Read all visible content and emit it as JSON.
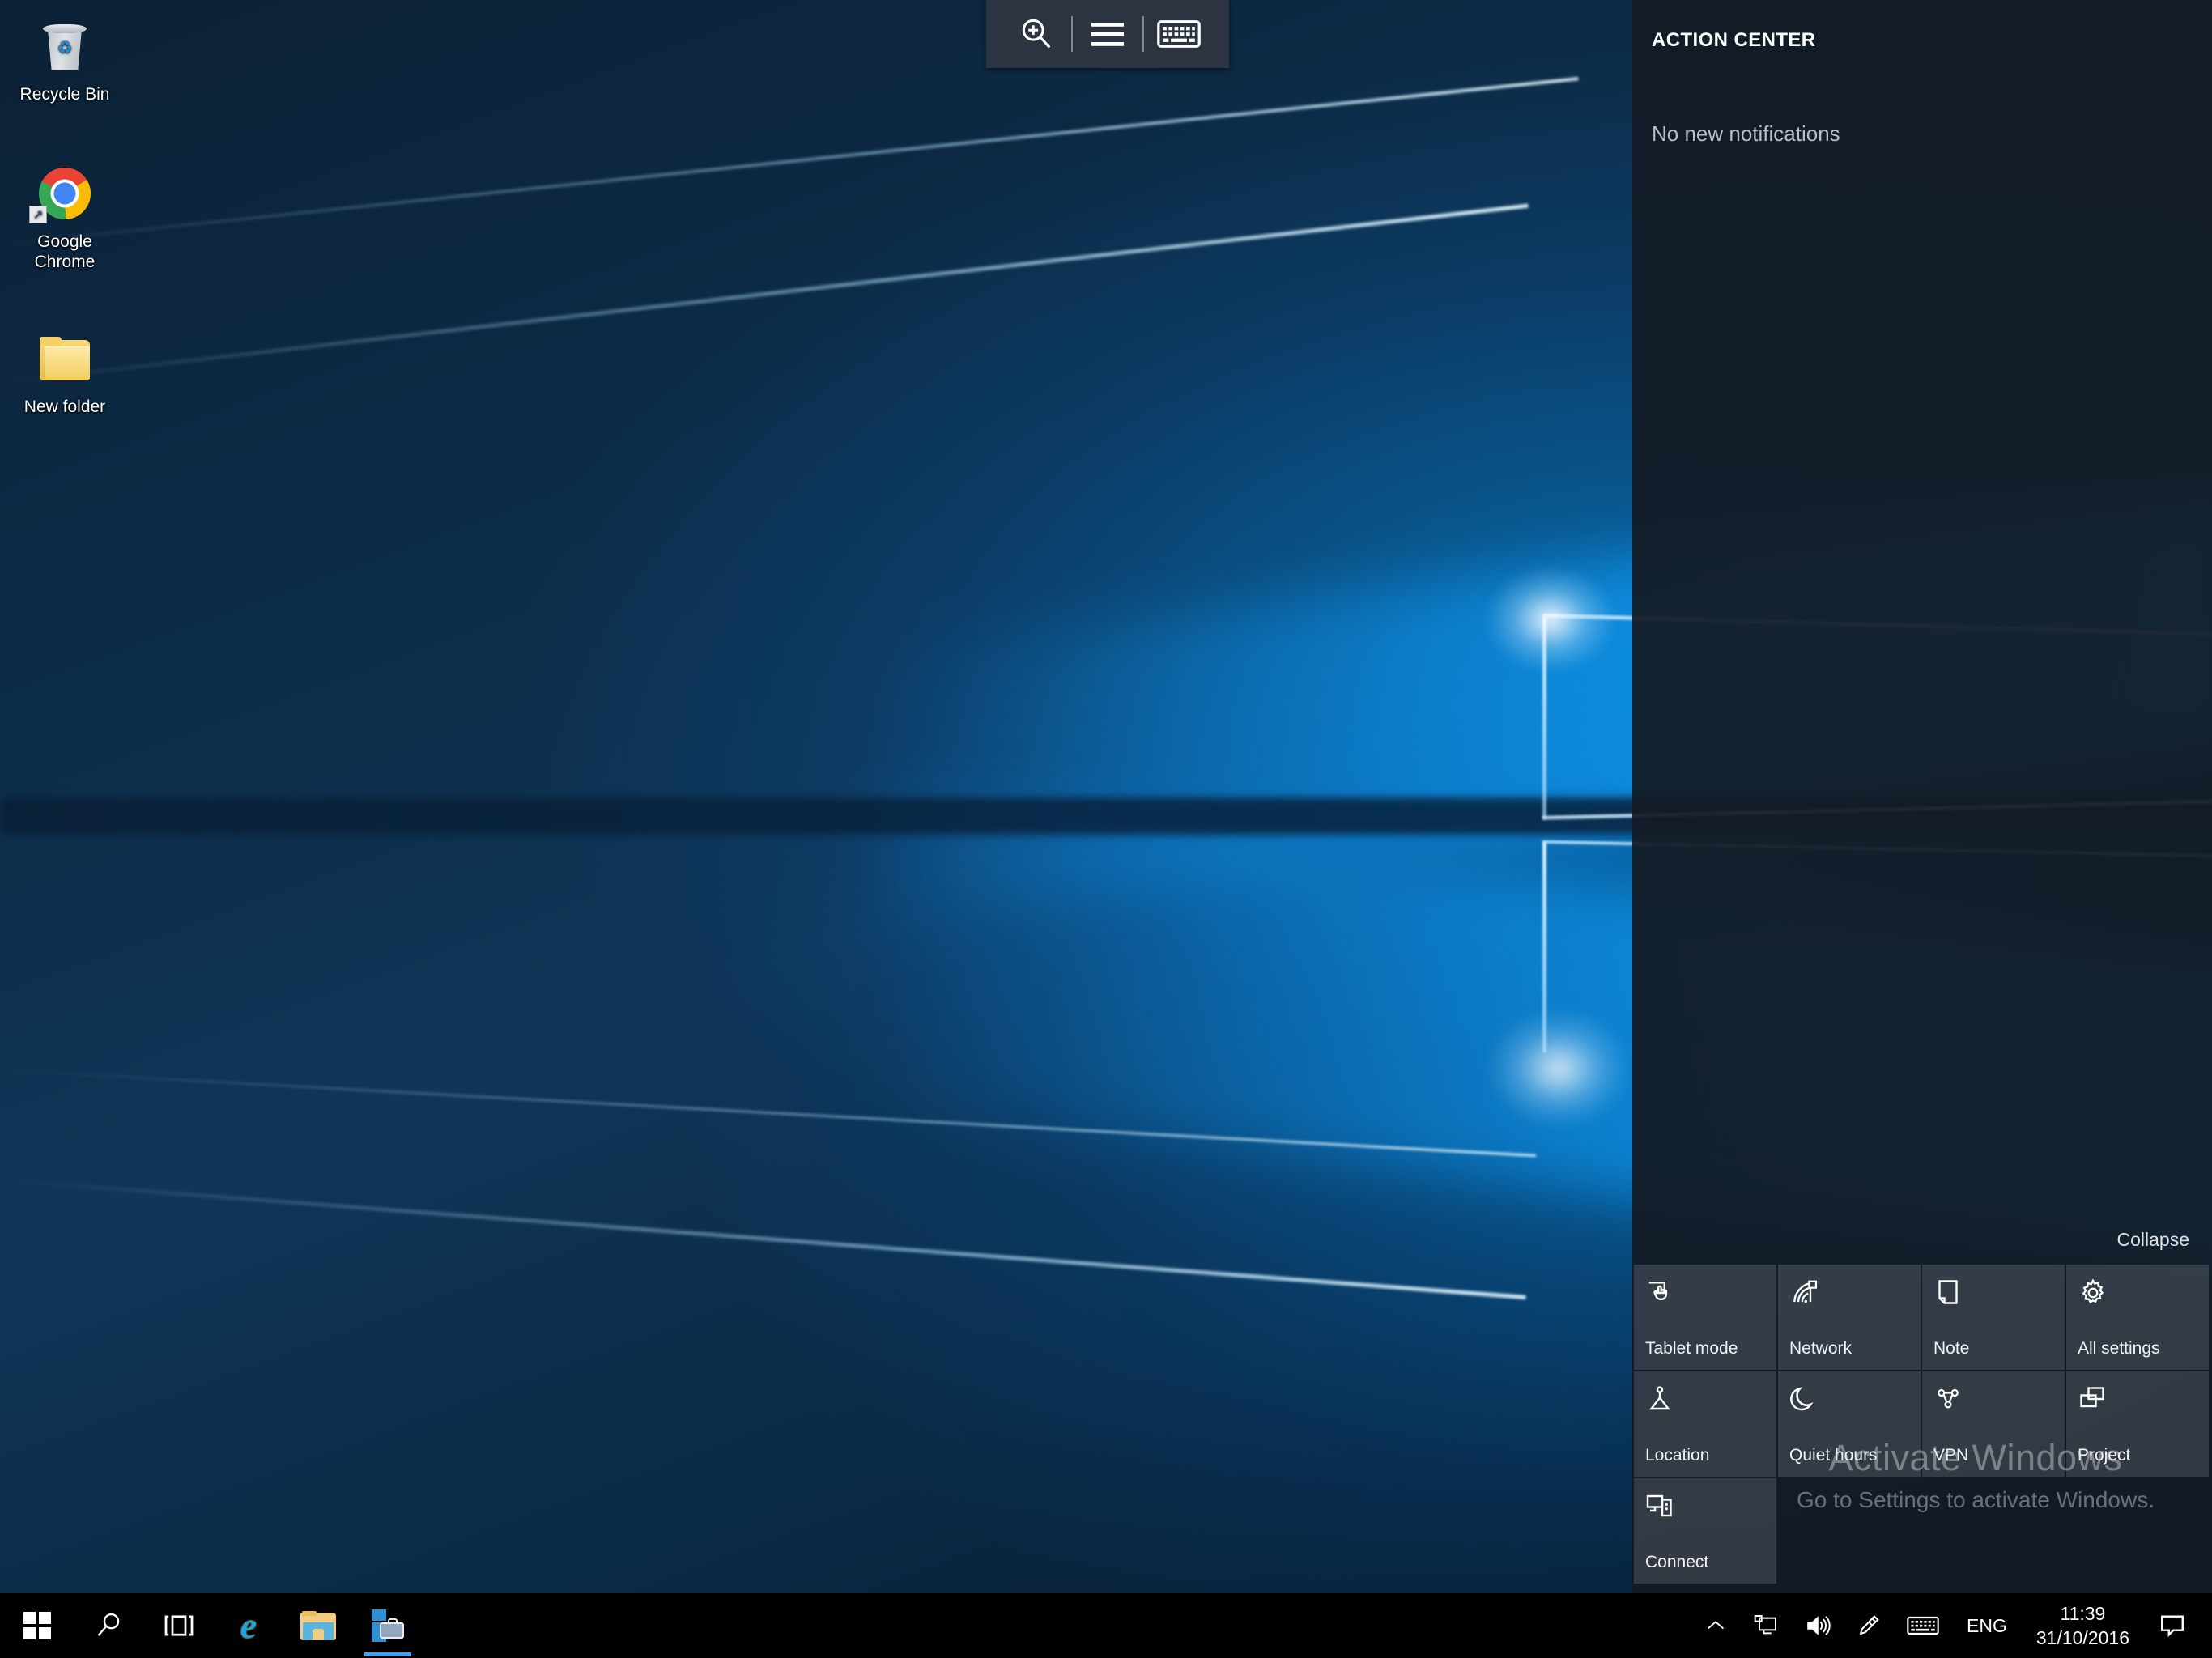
{
  "desktop": {
    "icons": [
      {
        "label": "Recycle Bin",
        "icon": "recycle-bin-icon"
      },
      {
        "label": "Google Chrome",
        "icon": "google-chrome-icon"
      },
      {
        "label": "New folder",
        "icon": "folder-icon"
      }
    ]
  },
  "magnifier_toolbar": {
    "zoom_in_label": "Zoom in",
    "views_label": "Views",
    "keyboard_label": "On-screen keyboard",
    "icons": [
      "magnifier-plus-icon",
      "hamburger-menu-icon",
      "keyboard-icon"
    ]
  },
  "action_center": {
    "title": "ACTION CENTER",
    "empty_message": "No new notifications",
    "collapse_label": "Collapse",
    "tiles": [
      {
        "label": "Tablet mode",
        "icon": "tablet-mode-icon"
      },
      {
        "label": "Network",
        "icon": "network-wifi-icon"
      },
      {
        "label": "Note",
        "icon": "note-icon"
      },
      {
        "label": "All settings",
        "icon": "gear-icon"
      },
      {
        "label": "Location",
        "icon": "location-icon"
      },
      {
        "label": "Quiet hours",
        "icon": "moon-icon"
      },
      {
        "label": "VPN",
        "icon": "vpn-icon"
      },
      {
        "label": "Project",
        "icon": "project-icon"
      },
      {
        "label": "Connect",
        "icon": "connect-icon"
      }
    ]
  },
  "watermark": {
    "line1": "Activate Windows",
    "line2": "Go to Settings to activate Windows."
  },
  "taskbar": {
    "start_label": "Start",
    "search_label": "Search",
    "task_view_label": "Task View",
    "apps": [
      {
        "label": "Internet Explorer",
        "icon": "internet-explorer-icon",
        "active": false
      },
      {
        "label": "File Explorer",
        "icon": "file-explorer-icon",
        "active": false
      },
      {
        "label": "Store",
        "icon": "store-icon",
        "active": true
      }
    ],
    "tray": {
      "show_hidden_label": "Show hidden icons",
      "network_label": "Network",
      "volume_label": "Speakers",
      "pen_label": "Windows Ink Workspace",
      "keyboard_label": "Touch keyboard",
      "language": "ENG",
      "time": "11:39",
      "date": "31/10/2016",
      "action_center_label": "Action Center"
    }
  },
  "colors": {
    "accent": "#3ea0e8",
    "taskbar_bg": "#000000",
    "action_center_bg": "#131a24",
    "tile_bg": "#3c4450",
    "toolbar_bg": "#2b3440"
  }
}
